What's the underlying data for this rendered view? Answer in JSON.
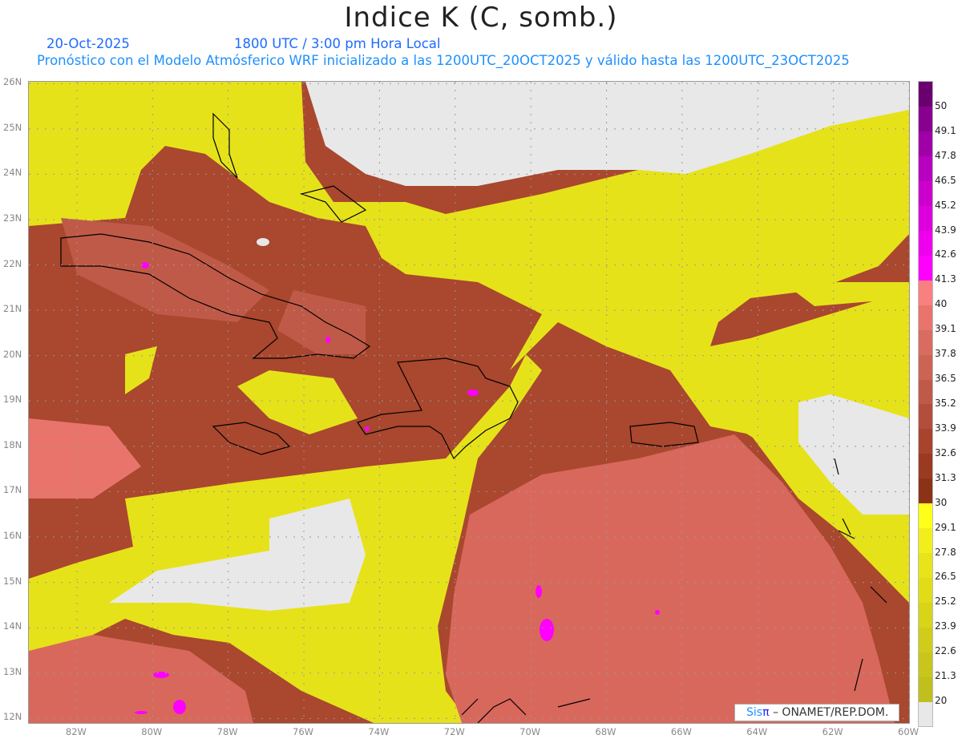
{
  "header": {
    "title": "Indice K (C, somb.)",
    "date": "20-Oct-2025",
    "time": "1800 UTC / 3:00 pm Hora Local",
    "description": "Pronóstico con el Modelo Atmósferico WRF inicializado a las 1200UTC_20OCT2025 y válido hasta las  1200UTC_23OCT2025"
  },
  "map": {
    "lon_range": [
      -83.27,
      -60
    ],
    "lat_range": [
      11.9,
      26.04
    ],
    "lon_ticks": [
      {
        "value": -82,
        "label": "82W"
      },
      {
        "value": -80,
        "label": "80W"
      },
      {
        "value": -78,
        "label": "78W"
      },
      {
        "value": -76,
        "label": "76W"
      },
      {
        "value": -74,
        "label": "74W"
      },
      {
        "value": -72,
        "label": "72W"
      },
      {
        "value": -70,
        "label": "70W"
      },
      {
        "value": -68,
        "label": "68W"
      },
      {
        "value": -66,
        "label": "66W"
      },
      {
        "value": -64,
        "label": "64W"
      },
      {
        "value": -62,
        "label": "62W"
      },
      {
        "value": -60,
        "label": "60W"
      }
    ],
    "lat_ticks": [
      {
        "value": 26,
        "label": "26N"
      },
      {
        "value": 25,
        "label": "25N"
      },
      {
        "value": 24,
        "label": "24N"
      },
      {
        "value": 23,
        "label": "23N"
      },
      {
        "value": 22,
        "label": "22N"
      },
      {
        "value": 21,
        "label": "21N"
      },
      {
        "value": 20,
        "label": "20N"
      },
      {
        "value": 19,
        "label": "19N"
      },
      {
        "value": 18,
        "label": "18N"
      },
      {
        "value": 17,
        "label": "17N"
      },
      {
        "value": 16,
        "label": "16N"
      },
      {
        "value": 15,
        "label": "15N"
      },
      {
        "value": 14,
        "label": "14N"
      },
      {
        "value": 13,
        "label": "13N"
      },
      {
        "value": 12,
        "label": "12N"
      }
    ]
  },
  "colorbar": {
    "labels": [
      "20",
      "21.3",
      "22.6",
      "23.9",
      "25.2",
      "26.5",
      "27.8",
      "29.1",
      "30",
      "31.3",
      "32.6",
      "33.9",
      "35.2",
      "36.5",
      "37.8",
      "39.1",
      "40",
      "41.3",
      "42.6",
      "43.9",
      "45.2",
      "46.5",
      "47.8",
      "49.1",
      "50"
    ],
    "colors": [
      "#e8e8e8",
      "#c0bf1e",
      "#c8c61c",
      "#d0cd1a",
      "#d8d418",
      "#e0dc18",
      "#e8e41a",
      "#f2ee1c",
      "#ffff1a",
      "#8b3318",
      "#9b3a22",
      "#a8442e",
      "#b44e3c",
      "#c05a48",
      "#cc6454",
      "#d86c60",
      "#e8746c",
      "#fa8080",
      "#ff00ff",
      "#ee00ee",
      "#dd00dd",
      "#cc00cc",
      "#b800c0",
      "#a000a8",
      "#880090",
      "#6a0070"
    ]
  },
  "credit": {
    "logo_sis": "Sis",
    "logo_pi": "π",
    "text": "– ONAMET/REP.DOM."
  }
}
